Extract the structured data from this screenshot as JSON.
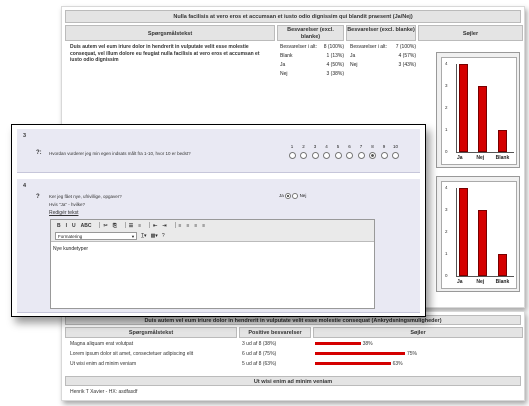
{
  "survey1": {
    "title": "Nulla facilisis at vero eros et accumsan et iusto odio dignissim qui blandit praesent (Ja/Nej)",
    "col_question": "Spørgsmålstekst",
    "col_resp1": "Besvarelser (excl. blanke)",
    "col_resp2": "Besvarelser (excl. blanke)",
    "col_chart": "Søjler",
    "question": "Duis autem vel eum iriure dolor in hendrerit in vulputate velit esse molestie consequat, vel illum dolore eu feugiat nulla facilisis at vero eros et accumsan et iusto odio dignissim",
    "rows1": [
      {
        "label": "Besvarelser i alt:",
        "value": "8 (100%)"
      },
      {
        "label": "Blank",
        "value": "1 (13%)"
      },
      {
        "label": "Ja",
        "value": "4 (50%)"
      },
      {
        "label": "Nej",
        "value": "3 (38%)"
      }
    ],
    "rows2": [
      {
        "label": "Besvarelser i alt:",
        "value": "7 (100%)"
      },
      {
        "label": "Ja",
        "value": "4 (57%)"
      },
      {
        "label": "Nej",
        "value": "3 (43%)"
      }
    ]
  },
  "chart_data": [
    {
      "type": "bar",
      "categories": [
        "Ja",
        "Nej",
        "Blank"
      ],
      "values": [
        4,
        3,
        1
      ],
      "ylim": [
        0,
        4
      ],
      "yticks": [
        "0",
        "1",
        "2",
        "3",
        "4"
      ]
    },
    {
      "type": "bar",
      "categories": [
        "Ja",
        "Nej",
        "Blank"
      ],
      "values": [
        4,
        3,
        1
      ],
      "ylim": [
        0,
        4
      ],
      "yticks": [
        "0",
        "1",
        "2",
        "3",
        "4"
      ]
    }
  ],
  "dialog": {
    "q3": {
      "number": "3",
      "marker": "?:",
      "text": "Hvordan vurderer jeg min egen indsats målt fra 1-10, hvor 10 er bedst?",
      "scale": [
        "1",
        "2",
        "3",
        "4",
        "5",
        "6",
        "7",
        "8",
        "9",
        "10"
      ],
      "selected_index": 7
    },
    "q4": {
      "number": "4",
      "marker": "?",
      "text": "Ker jeg fået nye, ufrivillige, opgaver?",
      "hint": "Hvis \"Ja\" - hvilke?",
      "link": "Redigér tekst",
      "opt_yes": "Ja",
      "opt_no": "Nej",
      "format_label": "Formatering",
      "body_text": "Nye kundetyper"
    }
  },
  "survey2": {
    "title": "Duis autem vel eum iriure dolor in hendrerit in vulputate velit esse molestie consequat (Ankrydsningsmuligheder)",
    "col_question": "Spørgsmålstekst",
    "col_pos": "Positive besvarelser",
    "col_chart": "Søjler",
    "rows": [
      {
        "text": "Magna aliquam erat volutpat",
        "count": "3 ud af 8 (38%)",
        "pct": 38,
        "pct_label": "38%"
      },
      {
        "text": "Lorem ipsum dolor sit amet, consectetuer adipiscing elit",
        "count": "6 ud af 8 (75%)",
        "pct": 75,
        "pct_label": "75%"
      },
      {
        "text": "Ut wisi enim ad minim veniam",
        "count": "5 ud af 8 (63%)",
        "pct": 63,
        "pct_label": "63%"
      }
    ],
    "footer_title": "Ut wisi enim ad minim veniam",
    "footer_text": "Henrik T Xavier - HX: asdfasdf"
  },
  "colors": {
    "bar": "#d40000",
    "dialog_row": "#e9e9f3"
  }
}
